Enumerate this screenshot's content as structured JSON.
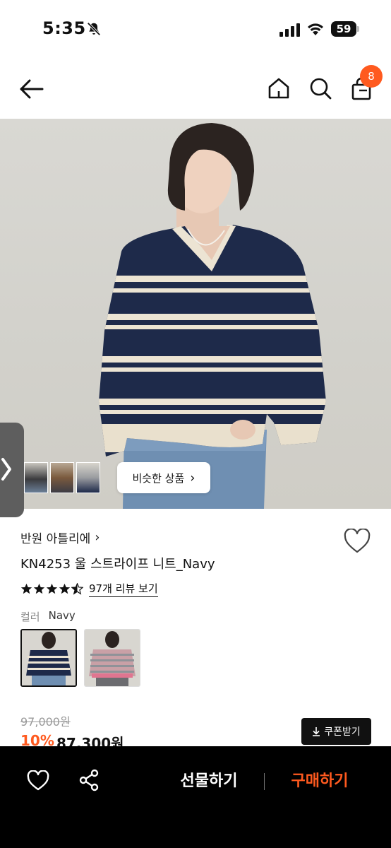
{
  "status_bar": {
    "time": "5:35",
    "battery": "59"
  },
  "nav": {
    "cart_count": "8"
  },
  "hero": {
    "similar_label": "비슷한 상품",
    "similar_arrow": "›"
  },
  "product": {
    "brand": "반원 아틀리에",
    "brand_arrow": "›",
    "name": "KN4253 울 스트라이프 니트_Navy",
    "rating": 4.5,
    "review_text": "97개 리뷰 보기",
    "color_label": "컬러",
    "color_value": "Navy",
    "original_price": "97,000원",
    "discount": "10%",
    "sale_price": "87,300원",
    "coupon_label": "쿠폰받기"
  },
  "bottom": {
    "gift_label": "선물하기",
    "buy_label": "구매하기"
  },
  "colors": {
    "accent": "#ff5a1f",
    "navy": "#1e2a4a",
    "cream": "#ece4d3"
  }
}
